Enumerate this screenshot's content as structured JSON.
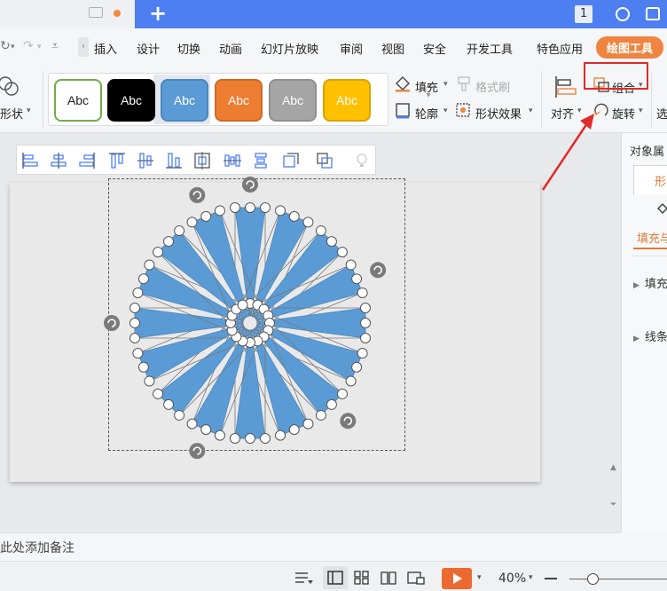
{
  "titlebar": {
    "plus": "+",
    "badge": "1"
  },
  "menu": {
    "items": [
      "插入",
      "设计",
      "切换",
      "动画",
      "幻灯片放映",
      "审阅",
      "视图",
      "安全",
      "开发工具",
      "特色应用"
    ],
    "active_tab": "绘图工具"
  },
  "ribbon": {
    "shape_label": "形状",
    "styles": [
      {
        "label": "Abc",
        "bg": "#ffffff",
        "fg": "#222222",
        "border": "#70ad47"
      },
      {
        "label": "Abc",
        "bg": "#000000",
        "fg": "#ffffff",
        "border": "#000000"
      },
      {
        "label": "Abc",
        "bg": "#5b9bd5",
        "fg": "#ffffff",
        "border": "#4a86bd"
      },
      {
        "label": "Abc",
        "bg": "#ed7d31",
        "fg": "#ffffff",
        "border": "#cc6a28"
      },
      {
        "label": "Abc",
        "bg": "#a5a5a5",
        "fg": "#ffffff",
        "border": "#8e8e8e"
      },
      {
        "label": "Abc",
        "bg": "#ffc000",
        "fg": "#ffffff",
        "border": "#d9a300"
      }
    ],
    "fill": "填充",
    "format_brush": "格式刷",
    "outline": "轮廓",
    "shape_effect": "形状效果",
    "align": "对齐",
    "group": "组合",
    "rotate": "旋转",
    "select": "选"
  },
  "right_panel": {
    "title": "对象属",
    "tab": "形",
    "fill_line": "填充与",
    "fill": "填充",
    "line": "线条"
  },
  "notes": {
    "placeholder": "此处添加备注"
  },
  "status": {
    "zoom": "40%"
  },
  "colors": {
    "accent": "#ef8541",
    "titlebar_blue": "#4e7ff0",
    "shape_blue": "#5b9bd5",
    "highlight_red": "#e02a2a"
  }
}
